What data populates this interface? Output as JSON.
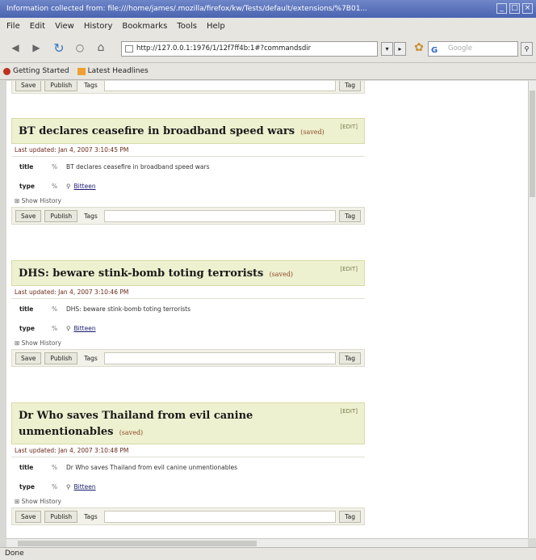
{
  "window": {
    "title": "Information collected from: file:///home/james/.mozilla/firefox/kw/Tests/default/extensions/%7B01..."
  },
  "menu": [
    "File",
    "Edit",
    "View",
    "History",
    "Bookmarks",
    "Tools",
    "Help"
  ],
  "nav": {
    "url": "http://127.0.0.1:1976/1/12f7ff4b:1#?commandsdir",
    "search_placeholder": "Google",
    "search_engine_icon": "G"
  },
  "bookmarks": [
    {
      "label": "Getting Started",
      "icon": "firefox-icon"
    },
    {
      "label": "Latest Headlines",
      "icon": "rss-icon"
    }
  ],
  "common": {
    "save_label": "Save",
    "publish_label": "Publish",
    "tags_label": "Tags",
    "tag_button_label": "Tag",
    "show_history_label": "Show History",
    "title_field_label": "title",
    "type_field_label": "type",
    "arrow": "%",
    "saved_label": "(saved)",
    "edit_label": "[EDIT]",
    "type_value": "Bitteen"
  },
  "items": [
    {
      "title": "BT declares ceasefire in broadband speed wars",
      "last_updated": "Last updated: Jan 4, 2007 3:10:45 PM",
      "title_value": "BT declares ceasefire in broadband speed wars"
    },
    {
      "title": "DHS: beware stink-bomb toting terrorists",
      "last_updated": "Last updated: Jan 4, 2007 3:10:46 PM",
      "title_value": "DHS: beware stink-bomb toting terrorists"
    },
    {
      "title": "Dr Who saves Thailand from evil canine unmentionables",
      "last_updated": "Last updated: Jan 4, 2007 3:10:48 PM",
      "title_value": "Dr Who saves Thailand from evil canine unmentionables"
    }
  ],
  "status": "Done"
}
